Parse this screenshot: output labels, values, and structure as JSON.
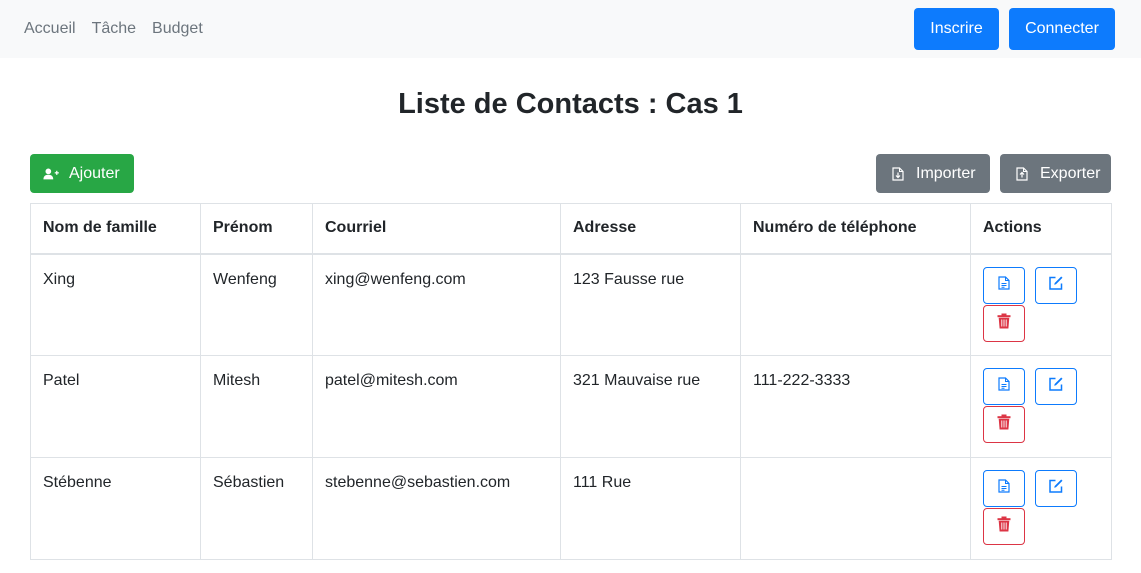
{
  "nav": {
    "links": [
      "Accueil",
      "Tâche",
      "Budget"
    ],
    "register_label": "Inscrire",
    "login_label": "Connecter"
  },
  "page": {
    "title": "Liste de Contacts : Cas 1"
  },
  "toolbar": {
    "add_label": "Ajouter",
    "import_label": "Importer",
    "export_label": "Exporter"
  },
  "table": {
    "headers": [
      "Nom de famille",
      "Prénom",
      "Courriel",
      "Adresse",
      "Numéro de téléphone",
      "Actions"
    ],
    "rows": [
      {
        "last_name": "Xing",
        "first_name": "Wenfeng",
        "email": "xing@wenfeng.com",
        "address": "123 Fausse rue",
        "phone": ""
      },
      {
        "last_name": "Patel",
        "first_name": "Mitesh",
        "email": "patel@mitesh.com",
        "address": "321 Mauvaise rue",
        "phone": "111-222-3333"
      },
      {
        "last_name": "Stébenne",
        "first_name": "Sébastien",
        "email": "stebenne@sebastien.com",
        "address": "111 Rue",
        "phone": ""
      }
    ]
  },
  "colors": {
    "primary": "#0d7bfd",
    "success": "#28a745",
    "secondary": "#6c757d",
    "danger": "#dc3545",
    "navbar_bg": "#f8f9fa"
  },
  "icons": {
    "add": "person-plus-icon",
    "import": "file-import-icon",
    "export": "file-export-icon",
    "view": "file-text-icon",
    "edit": "edit-icon",
    "delete": "trash-icon"
  }
}
